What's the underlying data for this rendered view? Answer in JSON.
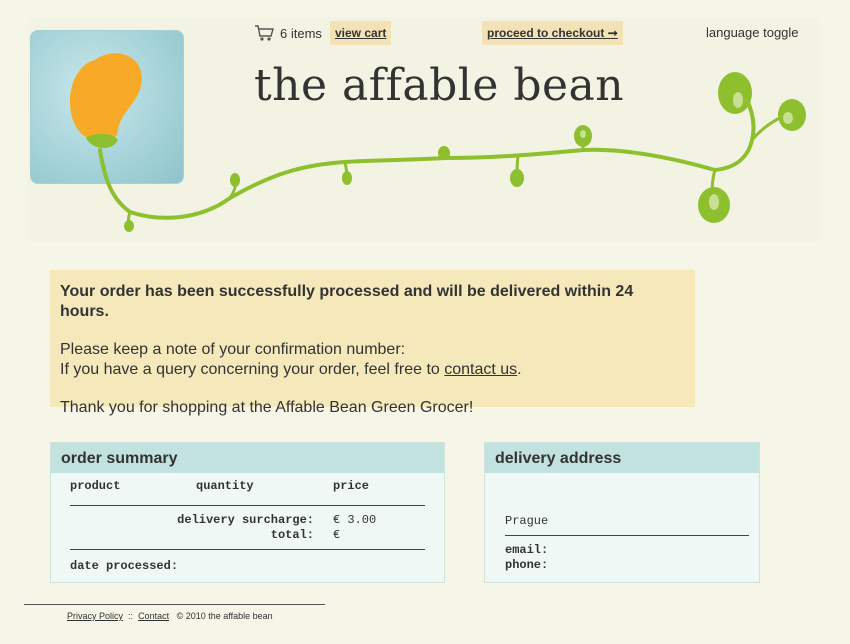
{
  "header": {
    "cart_count": "6 items",
    "view_cart": "view cart",
    "checkout": "proceed to checkout ➞",
    "language_toggle": "language toggle",
    "title": "the affable bean"
  },
  "message": {
    "heading": "Your order has been successfully processed and will be delivered within 24 hours.",
    "line1": "Please keep a note of your confirmation number:",
    "line2_prefix": "If you have a query concerning your order, feel free to ",
    "line2_link": "contact us",
    "line2_suffix": ".",
    "thanks": "Thank you for shopping at the Affable Bean Green Grocer!"
  },
  "order_summary": {
    "title": "order summary",
    "columns": [
      "product",
      "quantity",
      "price"
    ],
    "surcharge_label": "delivery surcharge:",
    "surcharge_value": "€ 3.00",
    "total_label": "total:",
    "total_value": "€",
    "date_label": "date processed:"
  },
  "delivery": {
    "title": "delivery address",
    "city": "Prague",
    "email_label": "email:",
    "phone_label": "phone:"
  },
  "footer": {
    "privacy": "Privacy Policy",
    "sep": "::",
    "contact": "Contact",
    "copyright": "©  2010 the affable bean"
  },
  "colors": {
    "page_bg": "#f5f5e8",
    "highlight": "#f2e2b5",
    "panel_head": "#c2e2df",
    "vine": "#8dbf2e",
    "bean": "#f7a928"
  },
  "icons": [
    "cart-icon",
    "bean-logo",
    "vine-graphic"
  ]
}
